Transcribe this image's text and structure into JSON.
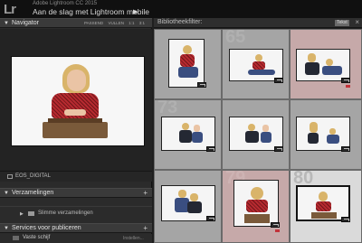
{
  "app": {
    "product": "Adobe Lightroom CC 2015",
    "title": "Aan de slag met Lightroom mobile",
    "logo": "Lr"
  },
  "navigator": {
    "title": "Navigator",
    "options": [
      "PASSEND",
      "VULLEN",
      "1:1",
      "3:1"
    ]
  },
  "catalog": {
    "label": "EOS_DIGITAL"
  },
  "collections": {
    "title": "Verzamelingen",
    "smart_label": "Slimme verzamelingen"
  },
  "publish": {
    "title": "Services voor publiceren",
    "item_label": "Vaste schijf",
    "item_action": "Instellen..."
  },
  "filter": {
    "label": "Bibliotheekfilter:",
    "tag": "Tekst"
  },
  "grid": {
    "cells": [
      {
        "number": "",
        "selected": false,
        "flag": false
      },
      {
        "number": "65",
        "selected": false,
        "flag": false
      },
      {
        "number": "",
        "selected": true,
        "flag": true
      },
      {
        "number": "73",
        "selected": false,
        "flag": false
      },
      {
        "number": "",
        "selected": false,
        "flag": false
      },
      {
        "number": "",
        "selected": false,
        "flag": false
      },
      {
        "number": "",
        "selected": false,
        "flag": false
      },
      {
        "number": "79",
        "selected": true,
        "flag": true
      },
      {
        "number": "80",
        "selected": false,
        "flag": false
      }
    ]
  },
  "colors": {
    "accent_flag": "#c2333a",
    "selected_cell": "#c6a9a9"
  }
}
